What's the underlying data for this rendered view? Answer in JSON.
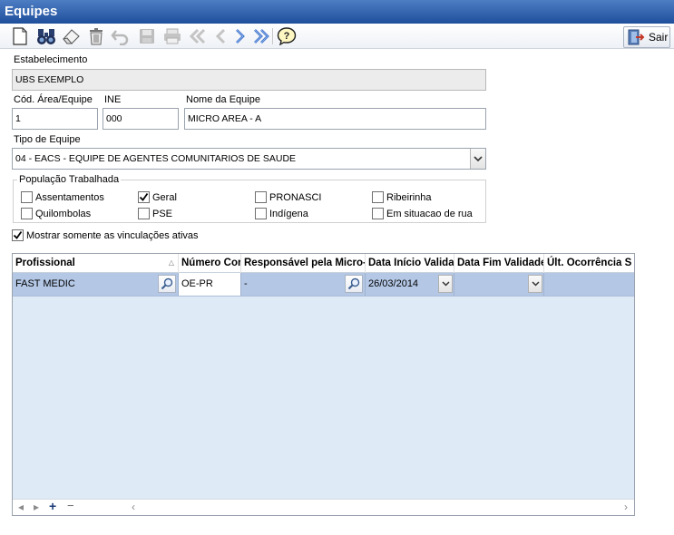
{
  "window": {
    "title": "Equipes"
  },
  "toolbar": {
    "buttons": [
      {
        "name": "new-icon",
        "label": "Novo"
      },
      {
        "name": "search-binoculars-icon",
        "label": "Pesquisar"
      },
      {
        "name": "eraser-icon",
        "label": "Limpar"
      },
      {
        "name": "trash-icon",
        "label": "Excluir"
      },
      {
        "name": "undo-icon",
        "label": "Desfazer"
      },
      {
        "name": "save-icon",
        "label": "Salvar"
      },
      {
        "name": "print-icon",
        "label": "Imprimir"
      },
      {
        "name": "first-icon",
        "label": "Primeiro"
      },
      {
        "name": "prev-icon",
        "label": "Anterior"
      },
      {
        "name": "next-icon",
        "label": "Próximo"
      },
      {
        "name": "last-icon",
        "label": "Último"
      },
      {
        "name": "help-icon",
        "label": "Ajuda"
      }
    ],
    "sair_label": "Sair"
  },
  "form": {
    "estabelecimento_label": "Estabelecimento",
    "estabelecimento_value": "UBS EXEMPLO",
    "cod_area_label": "Cód. Área/Equipe",
    "cod_area_value": "1",
    "ine_label": "INE",
    "ine_value": "000",
    "nome_label": "Nome da Equipe",
    "nome_value": "MICRO AREA - A",
    "tipo_label": "Tipo de Equipe",
    "tipo_value": "04 - EACS - EQUIPE DE AGENTES COMUNITARIOS DE SAUDE"
  },
  "populacao": {
    "title": "População Trabalhada",
    "items": [
      {
        "label": "Assentamentos",
        "checked": false
      },
      {
        "label": "Geral",
        "checked": true
      },
      {
        "label": "PRONASCI",
        "checked": false
      },
      {
        "label": "Ribeirinha",
        "checked": false
      },
      {
        "label": "Quilombolas",
        "checked": false
      },
      {
        "label": "PSE",
        "checked": false
      },
      {
        "label": "Indígena",
        "checked": false
      },
      {
        "label": "Em situacao de rua",
        "checked": false
      }
    ]
  },
  "mostrar_ativas": {
    "label": "Mostrar somente as vinculações ativas",
    "checked": true
  },
  "grid": {
    "columns": [
      "Profissional",
      "Número Cor",
      "Responsável pela Micro-",
      "Data Início Valida",
      "Data Fim Validade",
      "Últ. Ocorrência S"
    ],
    "rows": [
      {
        "profissional": "FAST MEDIC",
        "numero": "OE-PR",
        "responsavel": "-",
        "inicio": "26/03/2014",
        "fim": "",
        "ocorrencia": ""
      }
    ],
    "footer": {
      "add": "+",
      "remove": "−"
    }
  },
  "colors": {
    "title_bar": "#2a5ba8",
    "selected_row": "#b4c8e6",
    "grid_bg": "#deeaf5"
  }
}
